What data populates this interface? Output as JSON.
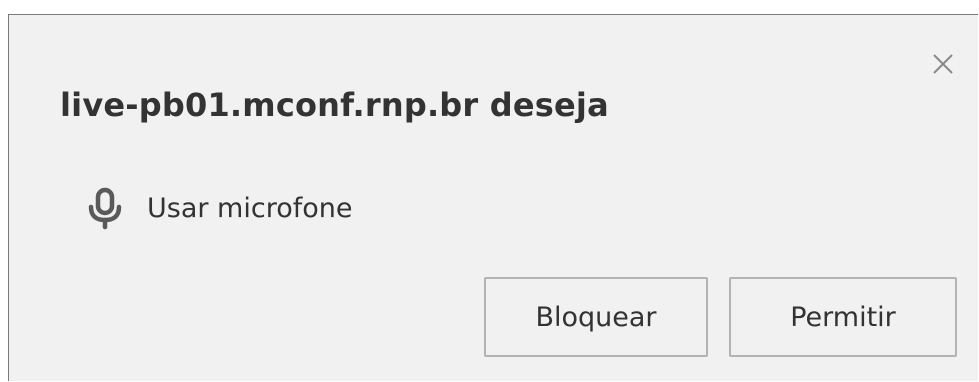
{
  "dialog": {
    "title": "live-pb01.mconf.rnp.br deseja",
    "close_icon": "close-icon",
    "permission": {
      "icon": "microphone-icon",
      "label": "Usar microfone"
    },
    "buttons": {
      "block_label": "Bloquear",
      "allow_label": "Permitir"
    }
  },
  "colors": {
    "background": "#f1f1f1",
    "text": "#333333",
    "button_border": "#b3b3b3",
    "frame_border": "#7b7b7b",
    "icon": "#5a5a5a"
  }
}
